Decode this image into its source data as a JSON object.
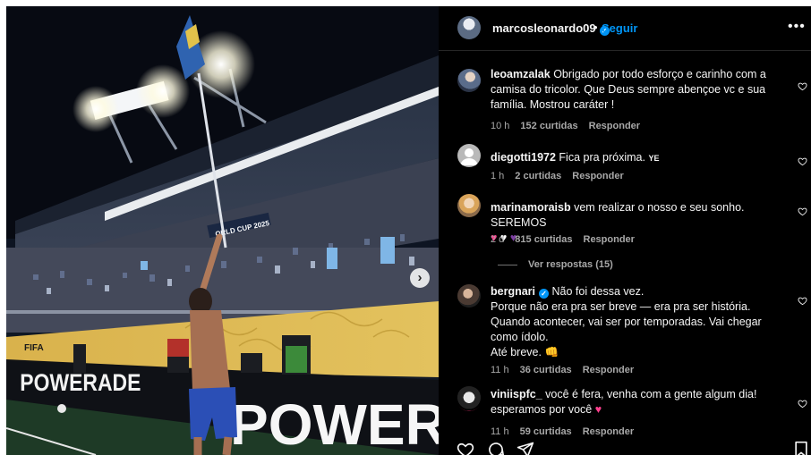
{
  "post": {
    "username": "marcosleonardo09",
    "separator": "•",
    "follow_label": "Seguir",
    "more_label": "•••"
  },
  "photo": {
    "next_label": "›",
    "banner_text": "POWERADE",
    "board_text": "POWER",
    "fifa_text": "FIFA",
    "cup_text": "ORLD CUP 2025"
  },
  "comments": [
    {
      "user": "leoamzalak",
      "text": "Obrigado por todo esforço e carinho com a camisa do tricolor. Que Deus sempre abençoe vc e sua família. Mostrou caráter !",
      "time": "10 h",
      "likes": "152 curtidas",
      "reply": "Responder"
    },
    {
      "user": "diegotti1972",
      "text": "Fica pra próxima.",
      "suffix": "YE",
      "time": "1 h",
      "likes": "2 curtidas",
      "reply": "Responder"
    },
    {
      "user": "marinamoraisb",
      "text": "vem realizar o nosso e seu sonho. SEREMOS",
      "hearts": [
        "♥",
        "♥",
        "♥"
      ],
      "time": "2 d",
      "likes": "815 curtidas",
      "reply": "Responder"
    },
    {
      "user": "bergnari",
      "text_lines": [
        "Não foi dessa vez.",
        "Porque não era pra ser breve — era pra ser história.",
        "Quando acontecer, vai ser por temporadas. Vai chegar como ídolo.",
        "Até breve."
      ],
      "emoji": "👊",
      "time": "11 h",
      "likes": "36 curtidas",
      "reply": "Responder"
    },
    {
      "user": "viniispfc_",
      "text": "você é fera, venha com a gente algum dia! esperamos por você",
      "emoji": "♥",
      "time": "11 h",
      "likes": "59 curtidas",
      "reply": "Responder"
    }
  ],
  "view_replies_label": "Ver respostas (15)",
  "icons": {
    "like": "heart-outline-icon",
    "comment": "comment-bubble-icon",
    "share": "paper-plane-icon",
    "save": "bookmark-icon",
    "verified": "verified-badge-icon"
  },
  "colors": {
    "link_blue": "#0095f6",
    "text_primary": "#f5f5f5",
    "text_secondary": "#a8a8a8",
    "panel_bg": "#000000"
  }
}
